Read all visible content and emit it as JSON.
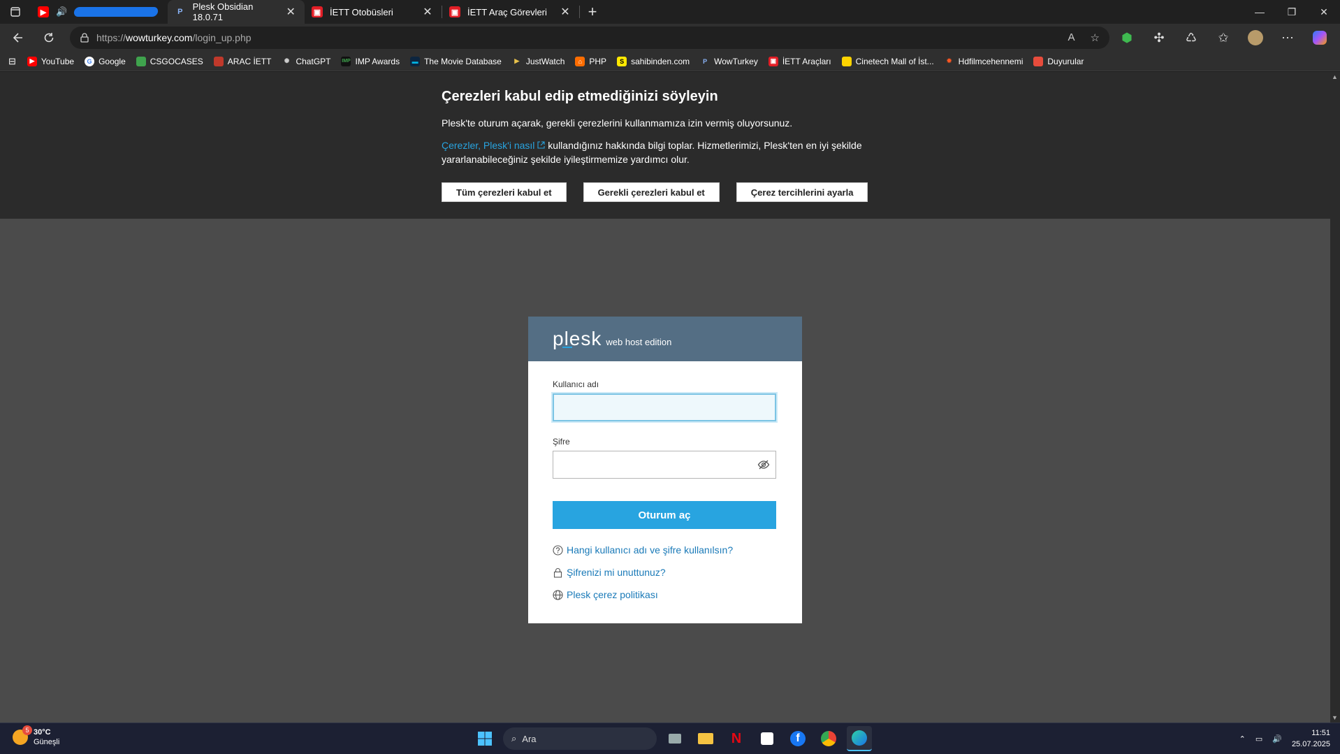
{
  "browser": {
    "tabs": [
      {
        "label": "",
        "muted_icon": "speaker-icon",
        "redacted": true
      },
      {
        "label": "Plesk Obsidian 18.0.71",
        "active": true
      },
      {
        "label": "İETT Otobüsleri"
      },
      {
        "label": "İETT Araç Görevleri"
      }
    ],
    "url": {
      "protocol": "https://",
      "domain": "wowturkey.com",
      "path": "/login_up.php"
    },
    "bookmarks": [
      {
        "label": "YouTube",
        "color": "#ff0000"
      },
      {
        "label": "Google",
        "color": "#ffffff"
      },
      {
        "label": "CSGOCASES",
        "color": "#3fa34d"
      },
      {
        "label": "ARAC İETT",
        "color": "#c0392b"
      },
      {
        "label": "ChatGPT",
        "color": "#cccccc"
      },
      {
        "label": "IMP Awards",
        "color": "#111111"
      },
      {
        "label": "The Movie Database",
        "color": "#0d253f"
      },
      {
        "label": "JustWatch",
        "color": "#e7c14b"
      },
      {
        "label": "PHP",
        "color": "#ff6d00"
      },
      {
        "label": "sahibinden.com",
        "color": "#ffe800"
      },
      {
        "label": "WowTurkey",
        "color": "#3a6ea5"
      },
      {
        "label": "İETT Araçları",
        "color": "#e21e26"
      },
      {
        "label": "Cinetech Mall of İst...",
        "color": "#ffd400"
      },
      {
        "label": "Hdfilmcehennemi",
        "color": "#ff5722"
      },
      {
        "label": "Duyurular",
        "color": "#e74c3c"
      }
    ]
  },
  "cookie_banner": {
    "title": "Çerezleri kabul edip etmediğinizi söyleyin",
    "line1": "Plesk'te oturum açarak, gerekli çerezlerini kullanmamıza izin vermiş oluyorsunuz.",
    "link": "Çerezler, Plesk'i nasıl",
    "line2_rest": " kullandığınız hakkında bilgi toplar. Hizmetlerimizi, Plesk'ten en iyi şekilde yararlanabileceğiniz şekilde iyileştirmemize yardımcı olur.",
    "btn_accept_all": "Tüm çerezleri kabul et",
    "btn_accept_required": "Gerekli çerezleri kabul et",
    "btn_settings": "Çerez tercihlerini ayarla"
  },
  "login": {
    "logo": "plesk",
    "edition": "web host edition",
    "username_label": "Kullanıcı adı",
    "username_value": "",
    "password_label": "Şifre",
    "password_value": "",
    "submit": "Oturum aç",
    "help_link": "Hangi kullanıcı adı ve şifre kullanılsın?",
    "forgot_link": "Şifrenizi mi unuttunuz?",
    "cookie_policy_link": "Plesk çerez politikası"
  },
  "taskbar": {
    "temperature": "30°C",
    "weather": "Güneşli",
    "weather_badge": "5",
    "search_placeholder": "Ara",
    "time": "11:51",
    "date": "25.07.2025"
  },
  "colors": {
    "accent": "#28a4e0",
    "login_header": "#546e84"
  }
}
